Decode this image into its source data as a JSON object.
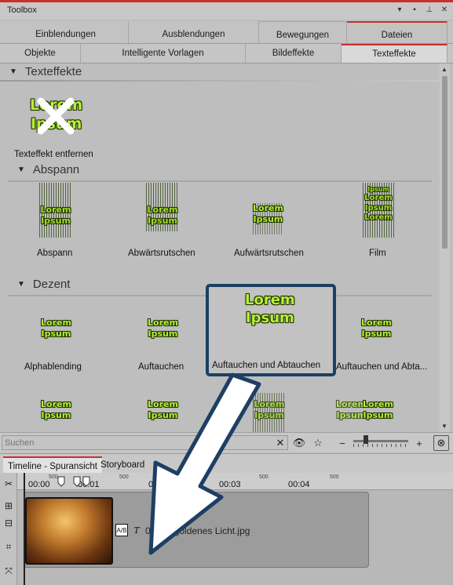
{
  "window": {
    "title": "Toolbox",
    "controls": [
      "▾",
      "▪",
      "⊥",
      "✕"
    ]
  },
  "tabs_row1": [
    {
      "label": "Einblendungen",
      "active": false
    },
    {
      "label": "Ausblendungen",
      "active": false
    },
    {
      "label": "Bewegungen",
      "active": false
    },
    {
      "label": "Dateien",
      "active": false
    }
  ],
  "tabs_row2": [
    {
      "label": "Objekte",
      "active": false
    },
    {
      "label": "Intelligente Vorlagen",
      "active": false
    },
    {
      "label": "Bildeffekte",
      "active": false
    },
    {
      "label": "Texteffekte",
      "active": true
    }
  ],
  "sections": {
    "texteffekte": "Texteffekte",
    "abspann": "Abspann",
    "dezent": "Dezent"
  },
  "thumb_text": {
    "line1": "Lorem",
    "line2": "Ipsum"
  },
  "items": {
    "remove": "Texteffekt entfernen",
    "abspann": [
      "Abspann",
      "Abwärtsrutschen",
      "Aufwärtsrutschen",
      "Film"
    ],
    "dezent": [
      "Alphablending",
      "Auftauchen",
      "Auftauchen und Abtauchen",
      "Auftauchen und Abta..."
    ]
  },
  "search": {
    "placeholder": "Suchen"
  },
  "timeline_tabs": [
    {
      "label": "Timeline - Spuransicht",
      "active": true
    },
    {
      "label": "Storyboard",
      "active": false
    }
  ],
  "ruler": {
    "times": [
      "00:01",
      "00:02",
      "00:03",
      "00:04"
    ],
    "start": "00:00",
    "sub": [
      "500",
      "500",
      "500",
      "500"
    ]
  },
  "clip": {
    "label": "00:05, goldenes Licht.jpg"
  },
  "colors": {
    "accent": "#c9302c",
    "highlight": "#1d3f63",
    "thumb_text": "#b5f03a"
  }
}
